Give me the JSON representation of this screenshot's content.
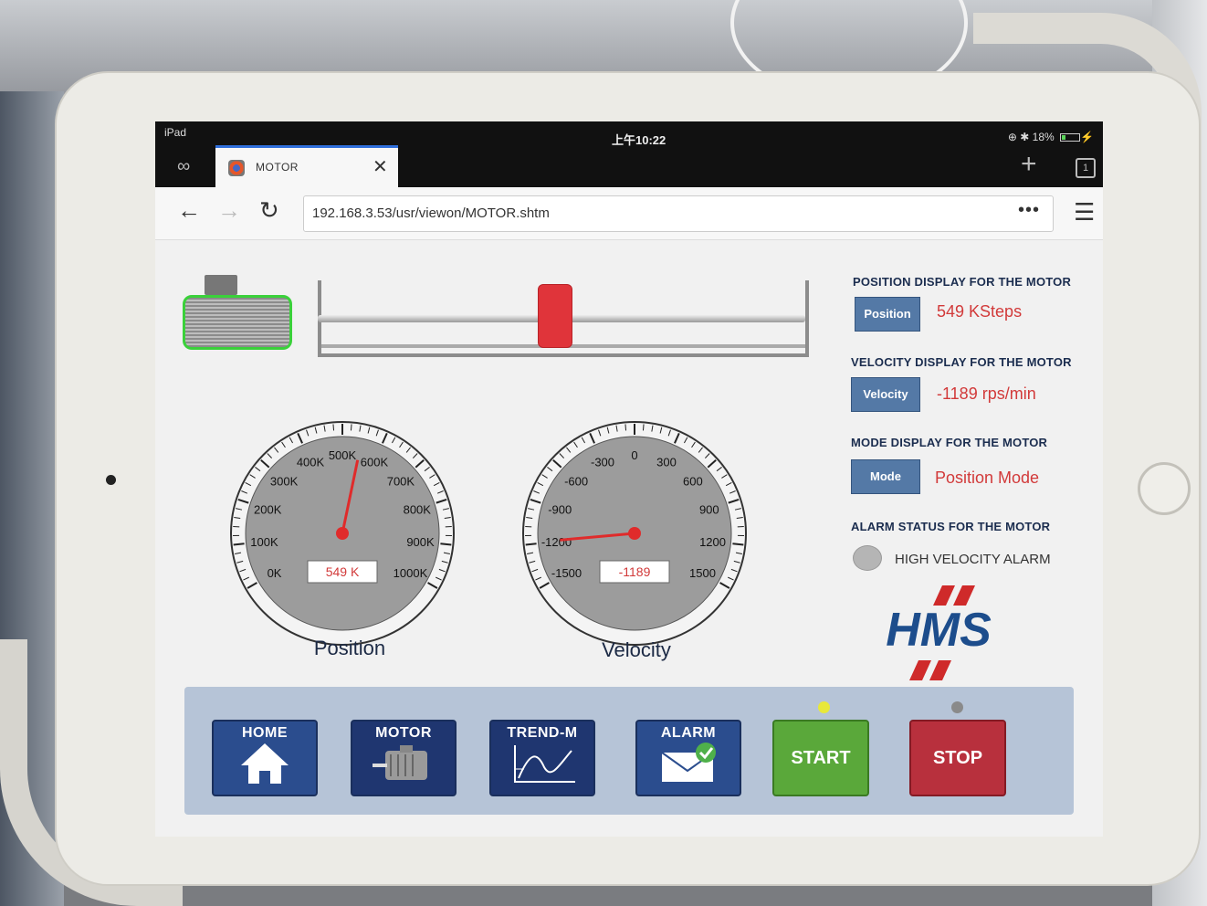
{
  "device": {
    "label": "iPad"
  },
  "statusbar": {
    "time": "上午10:22",
    "battery": "18%"
  },
  "tab": {
    "title": "MOTOR",
    "close_label": "✕"
  },
  "tabs_count": "1",
  "address": {
    "url": "192.168.3.53/usr/viewon/MOTOR.shtm"
  },
  "position_gauge": {
    "label": "Position",
    "readout": "549 K",
    "ticks": [
      "0K",
      "100K",
      "200K",
      "300K",
      "400K",
      "500K",
      "600K",
      "700K",
      "800K",
      "900K",
      "1000K"
    ],
    "min": 0,
    "max": 1000,
    "value": 549
  },
  "velocity_gauge": {
    "label": "Velocity",
    "readout": "-1189",
    "ticks": [
      "-1500",
      "-1200",
      "-900",
      "-600",
      "-300",
      "0",
      "300",
      "600",
      "900",
      "1200",
      "1500"
    ],
    "min": -1500,
    "max": 1500,
    "value": -1189
  },
  "slider": {
    "position_fraction": 0.49
  },
  "panel": {
    "position": {
      "heading": "POSITION DISPLAY FOR THE MOTOR",
      "button": "Position",
      "value": "549 KSteps"
    },
    "velocity": {
      "heading": "VELOCITY DISPLAY FOR THE MOTOR",
      "button": "Velocity",
      "value": "-1189 rps/min"
    },
    "mode": {
      "heading": "MODE DISPLAY FOR THE MOTOR",
      "button": "Mode",
      "value": "Position Mode"
    },
    "alarm": {
      "heading": "ALARM STATUS FOR THE MOTOR",
      "label": "HIGH VELOCITY ALARM"
    },
    "logo": "HMS"
  },
  "nav": {
    "home": "HOME",
    "motor": "MOTOR",
    "trend": "TREND-M",
    "alarm": "ALARM",
    "start": "START",
    "stop": "STOP"
  },
  "colors": {
    "accent": "#2b4d8e",
    "value_red": "#d23a3a",
    "start_led": "#e8e83a",
    "stop_led": "#8a8a8a"
  }
}
